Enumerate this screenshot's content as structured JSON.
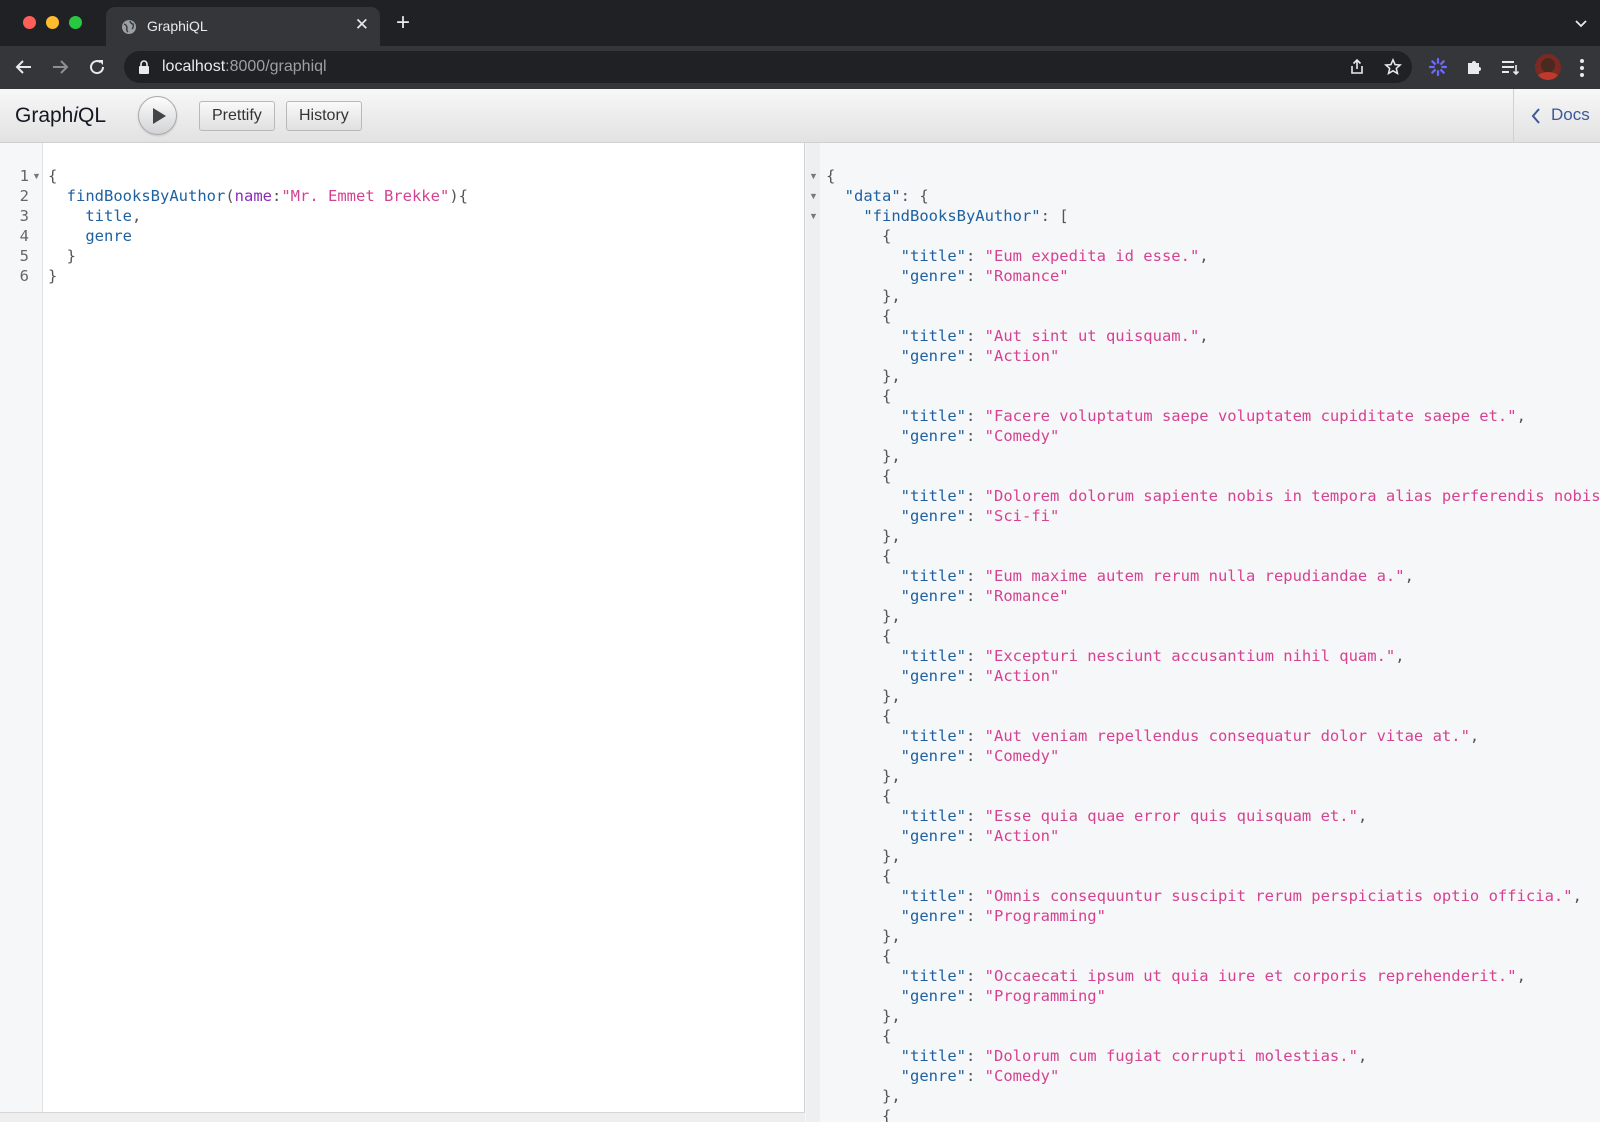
{
  "browser": {
    "tab_title": "GraphiQL",
    "url_host": "localhost",
    "url_rest": ":8000/graphiql"
  },
  "graphiql": {
    "title_pre": "Graph",
    "title_i": "i",
    "title_post": "QL",
    "prettify_label": "Prettify",
    "history_label": "History",
    "docs_label": "Docs"
  },
  "query": {
    "field": "findBooksByAuthor",
    "arg_name": "name",
    "arg_value": "\"Mr. Emmet Brekke\"",
    "subfields": [
      "title",
      "genre"
    ],
    "line_numbers": [
      "1",
      "2",
      "3",
      "4",
      "5",
      "6"
    ]
  },
  "results": {
    "data_key": "\"data\"",
    "root_field_key": "\"findBooksByAuthor\"",
    "title_key": "\"title\"",
    "genre_key": "\"genre\"",
    "books": [
      {
        "title": "\"Eum expedita id esse.\"",
        "genre": "\"Romance\""
      },
      {
        "title": "\"Aut sint ut quisquam.\"",
        "genre": "\"Action\""
      },
      {
        "title": "\"Facere voluptatum saepe voluptatem cupiditate saepe et.\"",
        "genre": "\"Comedy\""
      },
      {
        "title": "\"Dolorem dolorum sapiente nobis in tempora alias perferendis nobis.\"",
        "genre": "\"Sci-fi\""
      },
      {
        "title": "\"Eum maxime autem rerum nulla repudiandae a.\"",
        "genre": "\"Romance\""
      },
      {
        "title": "\"Excepturi nesciunt accusantium nihil quam.\"",
        "genre": "\"Action\""
      },
      {
        "title": "\"Aut veniam repellendus consequatur dolor vitae at.\"",
        "genre": "\"Comedy\""
      },
      {
        "title": "\"Esse quia quae error quis quisquam et.\"",
        "genre": "\"Action\""
      },
      {
        "title": "\"Omnis consequuntur suscipit rerum perspiciatis optio officia.\"",
        "genre": "\"Programming\""
      },
      {
        "title": "\"Occaecati ipsum ut quia iure et corporis reprehenderit.\"",
        "genre": "\"Programming\""
      },
      {
        "title": "\"Dolorum cum fugiat corrupti molestias.\"",
        "genre": "\"Comedy\""
      }
    ]
  },
  "colors": {
    "field": "#1f61a0",
    "attribute": "#8b2bb9",
    "string": "#d64292",
    "docs_link": "#3b5998"
  },
  "icons": [
    "globe-icon",
    "close-icon",
    "plus-icon",
    "chevron-down-icon",
    "back-arrow-icon",
    "forward-arrow-icon",
    "reload-icon",
    "lock-icon",
    "share-icon",
    "star-icon",
    "extension-icon",
    "puzzle-icon",
    "reading-list-icon",
    "kebab-menu-icon",
    "play-icon",
    "chevron-left-icon"
  ]
}
